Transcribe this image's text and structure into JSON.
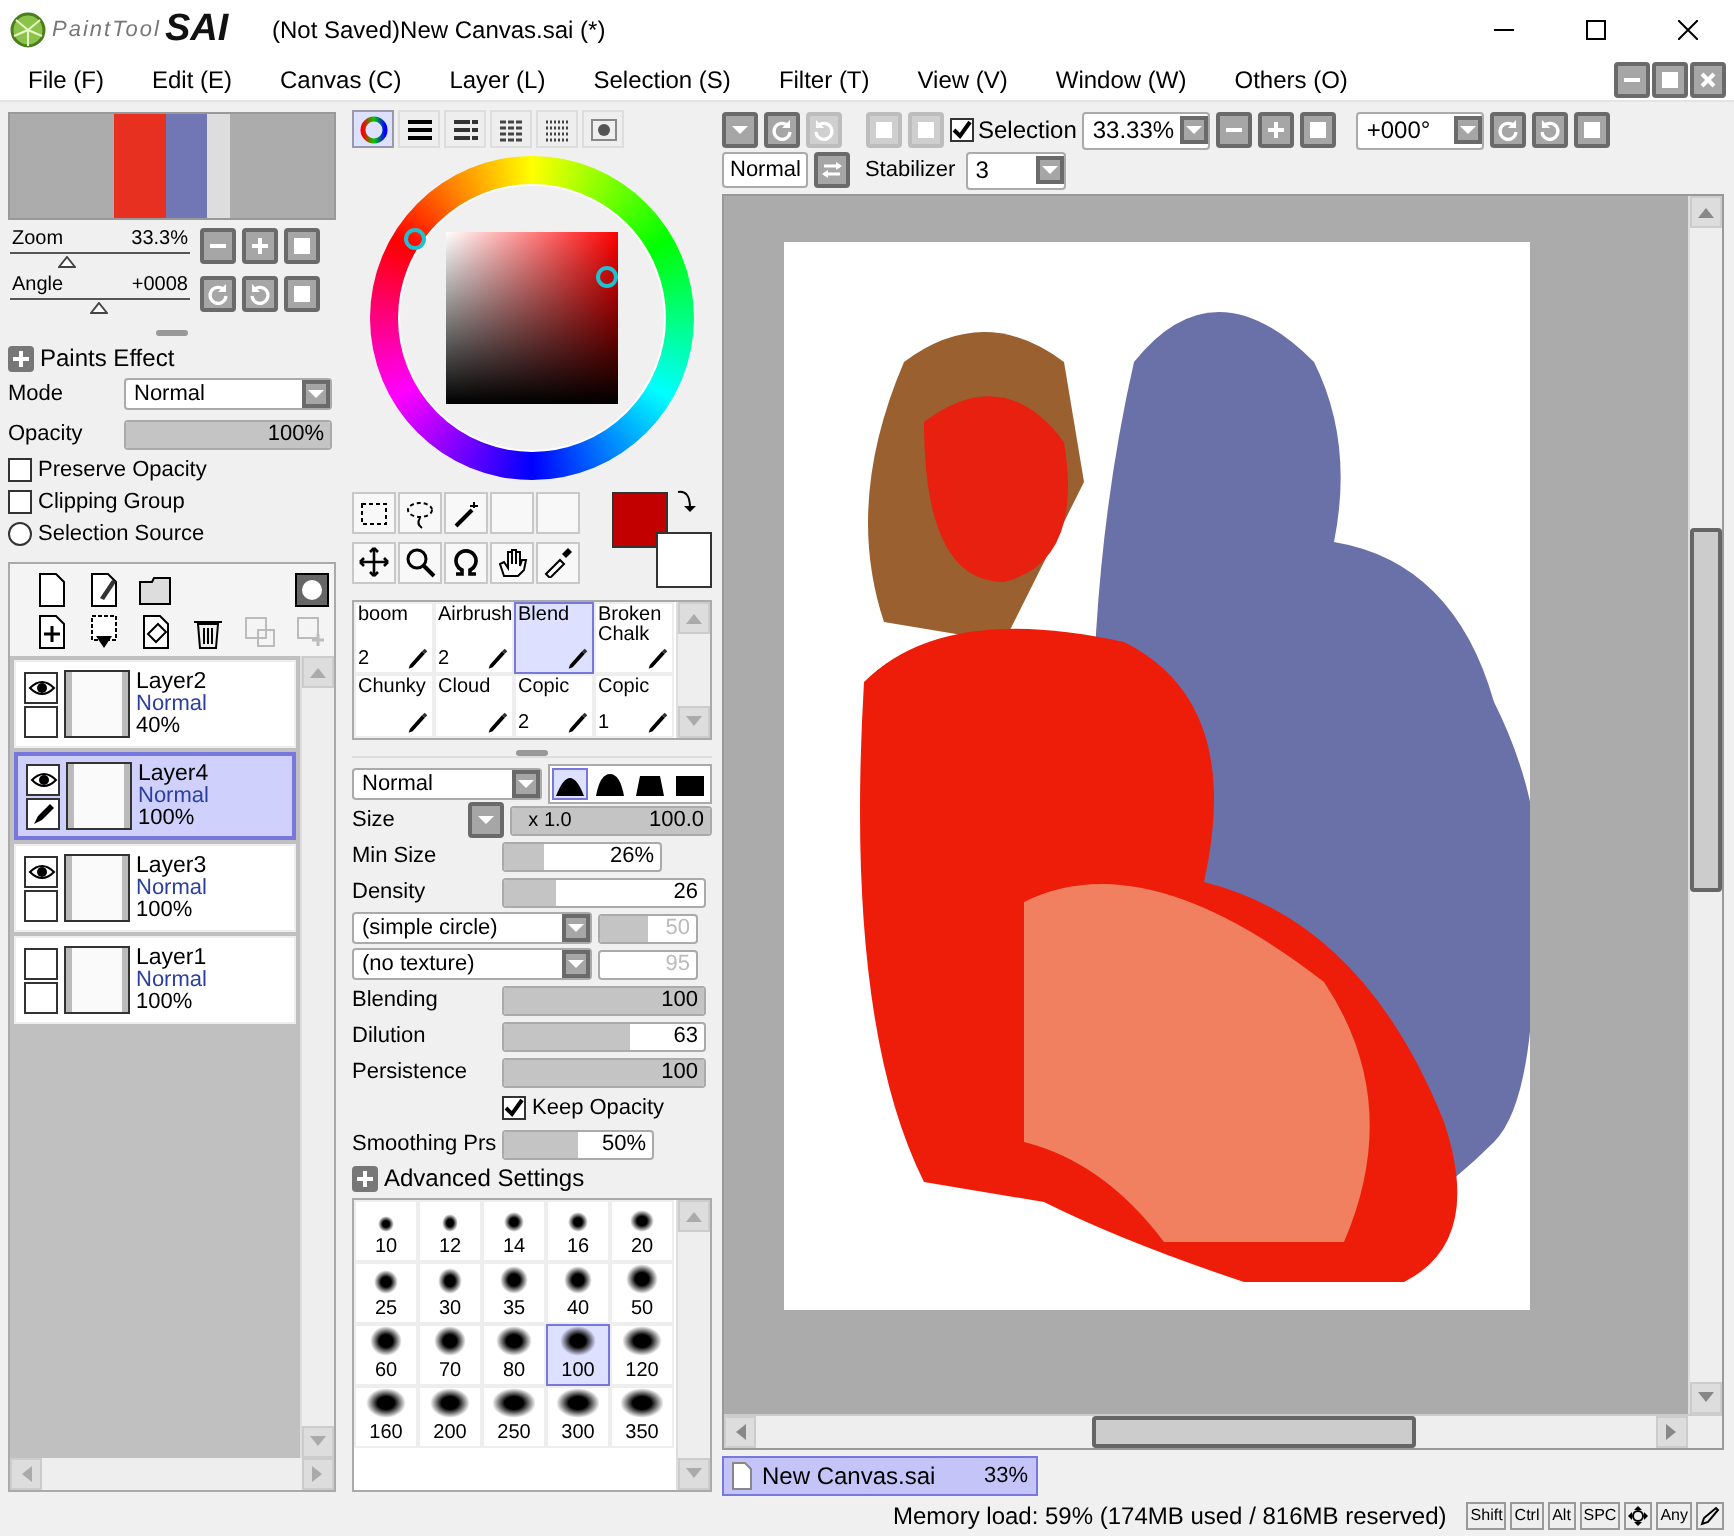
{
  "window": {
    "title": "(Not Saved)New Canvas.sai (*)"
  },
  "logo": {
    "script": "PaintTool",
    "mark": "SAI"
  },
  "menu": [
    "File (F)",
    "Edit (E)",
    "Canvas (C)",
    "Layer (L)",
    "Selection (S)",
    "Filter (T)",
    "View (V)",
    "Window (W)",
    "Others (O)"
  ],
  "navigator": {
    "zoom": {
      "label": "Zoom",
      "value": "33.3%",
      "level": 0.32
    },
    "angle": {
      "label": "Angle",
      "value": "+0008",
      "level": 0.5
    }
  },
  "paints_effect": {
    "title": "Paints Effect",
    "mode_label": "Mode",
    "mode": "Normal",
    "opacity_label": "Opacity",
    "opacity": "100%",
    "level": 1,
    "options": [
      {
        "kind": "checkbox",
        "label": "Preserve Opacity",
        "checked": false
      },
      {
        "kind": "checkbox",
        "label": "Clipping Group",
        "checked": false
      },
      {
        "kind": "radio",
        "label": "Selection Source",
        "checked": false
      }
    ]
  },
  "layers": [
    {
      "name": "Layer2",
      "mode": "Normal",
      "opacity": "40%",
      "visible": true,
      "selected": false
    },
    {
      "name": "Layer4",
      "mode": "Normal",
      "opacity": "100%",
      "visible": true,
      "selected": true
    },
    {
      "name": "Layer3",
      "mode": "Normal",
      "opacity": "100%",
      "visible": true,
      "selected": false
    },
    {
      "name": "Layer1",
      "mode": "Normal",
      "opacity": "100%",
      "visible": false,
      "selected": false
    }
  ],
  "color_tabs": [
    {
      "kind": "wheel",
      "selected": true
    },
    {
      "kind": "rgb",
      "selected": false
    },
    {
      "kind": "hsv",
      "selected": false
    },
    {
      "kind": "swatches",
      "selected": false
    },
    {
      "kind": "palette",
      "selected": false
    },
    {
      "kind": "scratchpad",
      "selected": false
    }
  ],
  "color_swatches": [
    {
      "kind": "primary",
      "color": "#c20000"
    },
    {
      "kind": "secondary",
      "color": "#ffffff"
    }
  ],
  "brushes": [
    {
      "name": "boom",
      "number": "2",
      "selected": false
    },
    {
      "name": "Airbrush",
      "number": "2",
      "selected": false
    },
    {
      "name": "Blend",
      "selected": true
    },
    {
      "name": "Broken Chalk",
      "selected": false
    },
    {
      "name": "Chunky",
      "selected": false
    },
    {
      "name": "Cloud",
      "selected": false
    },
    {
      "name": "Copic",
      "number": "2",
      "selected": false
    },
    {
      "name": "Copic",
      "number": "1",
      "selected": false
    }
  ],
  "brush_settings": {
    "blend_mode": "Normal",
    "edge_shapes": [
      {
        "selected": true
      },
      {
        "selected": false
      },
      {
        "selected": false
      },
      {
        "selected": false
      }
    ],
    "size": {
      "label": "Size",
      "multiplier": "x 1.0",
      "value": "100.0",
      "level": 1
    },
    "min_size": {
      "label": "Min Size",
      "value": "26%",
      "level": 0.26
    },
    "density": {
      "label": "Density",
      "value": "26",
      "level": 0.26
    },
    "shape": {
      "value": "(simple circle)",
      "amount": "50",
      "level": 0.5,
      "disabled": true
    },
    "texture": {
      "value": "(no texture)",
      "amount": "95",
      "disabled": true
    },
    "blending": {
      "label": "Blending",
      "value": "100",
      "level": 1
    },
    "dilution": {
      "label": "Dilution",
      "value": "63",
      "level": 0.63
    },
    "persistence": {
      "label": "Persistence",
      "value": "100",
      "level": 1
    },
    "keep_opacity": {
      "label": "Keep Opacity",
      "checked": true
    },
    "smoothing": {
      "label": "Smoothing Prs",
      "value": "50%",
      "level": 0.5
    },
    "advanced": {
      "title": "Advanced Settings"
    }
  },
  "brush_sizes": [
    {
      "label": "10",
      "selected": false
    },
    {
      "label": "12",
      "selected": false
    },
    {
      "label": "14",
      "selected": false
    },
    {
      "label": "16",
      "selected": false
    },
    {
      "label": "20",
      "selected": false
    },
    {
      "label": "25",
      "selected": false
    },
    {
      "label": "30",
      "selected": false
    },
    {
      "label": "35",
      "selected": false
    },
    {
      "label": "40",
      "selected": false
    },
    {
      "label": "50",
      "selected": false
    },
    {
      "label": "60",
      "selected": false
    },
    {
      "label": "70",
      "selected": false
    },
    {
      "label": "80",
      "selected": false
    },
    {
      "label": "100",
      "selected": true
    },
    {
      "label": "120",
      "selected": false
    },
    {
      "label": "160",
      "selected": false
    },
    {
      "label": "200",
      "selected": false
    },
    {
      "label": "250",
      "selected": false
    },
    {
      "label": "300",
      "selected": false
    },
    {
      "label": "350",
      "selected": false
    }
  ],
  "canvas_toolbar": {
    "selection": {
      "label": "Selection",
      "checked": true
    },
    "zoom": "33.33%",
    "angle": "+000°",
    "blend_mode": "Normal",
    "stabilizer_label": "Stabilizer",
    "stabilizer": "3"
  },
  "documents": [
    {
      "name": "New Canvas.sai",
      "zoom": "33%",
      "selected": true
    }
  ],
  "status_bar": {
    "memory": "Memory load: 59% (174MB used / 816MB reserved)",
    "keys": [
      {
        "kind": "text",
        "label": "Shift"
      },
      {
        "kind": "text",
        "label": "Ctrl"
      },
      {
        "kind": "text",
        "label": "Alt"
      },
      {
        "kind": "text",
        "label": "SPC"
      },
      {
        "kind": "move"
      },
      {
        "kind": "text",
        "label": "Any"
      },
      {
        "kind": "pen"
      }
    ]
  }
}
